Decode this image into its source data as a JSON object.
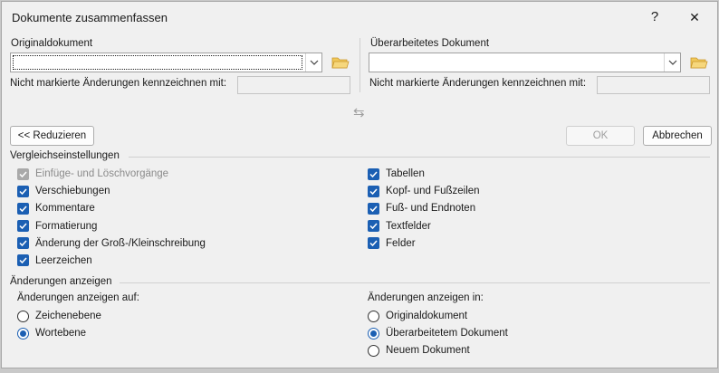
{
  "window": {
    "title": "Dokumente zusammenfassen",
    "help_symbol": "?",
    "close_symbol": "✕"
  },
  "original": {
    "label": "Originaldokument",
    "value": "",
    "unmarked_label": "Nicht markierte Änderungen kennzeichnen mit:",
    "unmarked_value": ""
  },
  "revised": {
    "label": "Überarbeitetes Dokument",
    "value": "",
    "unmarked_label": "Nicht markierte Änderungen kennzeichnen mit:",
    "unmarked_value": ""
  },
  "swap_symbol": "⇆",
  "buttons": {
    "reduce": "<< Reduzieren",
    "ok": "OK",
    "cancel": "Abbrechen"
  },
  "comparison": {
    "title": "Vergleichseinstellungen",
    "left": [
      {
        "label": "Einfüge- und Löschvorgänge",
        "checked": true,
        "enabled": false
      },
      {
        "label": "Verschiebungen",
        "checked": true,
        "enabled": true
      },
      {
        "label": "Kommentare",
        "checked": true,
        "enabled": true
      },
      {
        "label": "Formatierung",
        "checked": true,
        "enabled": true
      },
      {
        "label": "Änderung der Groß-/Kleinschreibung",
        "checked": true,
        "enabled": true
      },
      {
        "label": "Leerzeichen",
        "checked": true,
        "enabled": true
      }
    ],
    "right": [
      {
        "label": "Tabellen",
        "checked": true,
        "enabled": true
      },
      {
        "label": "Kopf- und Fußzeilen",
        "checked": true,
        "enabled": true
      },
      {
        "label": "Fuß- und Endnoten",
        "checked": true,
        "enabled": true
      },
      {
        "label": "Textfelder",
        "checked": true,
        "enabled": true
      },
      {
        "label": "Felder",
        "checked": true,
        "enabled": true
      }
    ]
  },
  "show_changes": {
    "title": "Änderungen anzeigen",
    "at_label": "Änderungen anzeigen auf:",
    "at_options": [
      {
        "label": "Zeichenebene",
        "selected": false
      },
      {
        "label": "Wortebene",
        "selected": true
      }
    ],
    "in_label": "Änderungen anzeigen in:",
    "in_options": [
      {
        "label": "Originaldokument",
        "selected": false
      },
      {
        "label": "Überarbeitetem Dokument",
        "selected": true
      },
      {
        "label": "Neuem Dokument",
        "selected": false
      }
    ]
  },
  "colors": {
    "accent": "#1b5fb3",
    "folder": "#e8b84a"
  }
}
